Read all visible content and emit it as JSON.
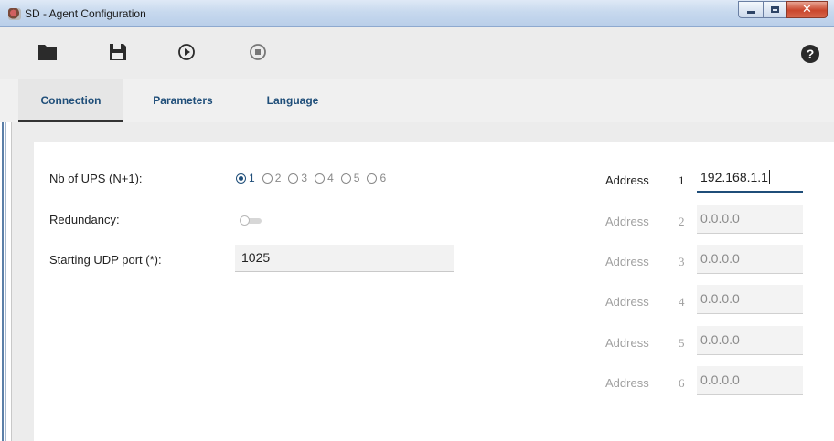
{
  "window": {
    "title": "SD - Agent Configuration"
  },
  "toolbar": {
    "icons": [
      "folder-icon",
      "save-icon",
      "play-icon",
      "stop-icon",
      "help-icon"
    ],
    "help_glyph": "?"
  },
  "tabs": [
    {
      "label": "Connection",
      "active": true
    },
    {
      "label": "Parameters",
      "active": false
    },
    {
      "label": "Language",
      "active": false
    }
  ],
  "connection": {
    "nb_ups_label": "Nb of UPS (N+1):",
    "nb_ups_options": [
      "1",
      "2",
      "3",
      "4",
      "5",
      "6"
    ],
    "nb_ups_selected": "1",
    "redundancy_label": "Redundancy:",
    "redundancy_enabled": false,
    "udp_port_label": "Starting UDP port (*):",
    "udp_port_value": "1025",
    "addresses": [
      {
        "label": "Address",
        "num": "1",
        "value": "192.168.1.1",
        "active": true
      },
      {
        "label": "Address",
        "num": "2",
        "value": "0.0.0.0",
        "active": false
      },
      {
        "label": "Address",
        "num": "3",
        "value": "0.0.0.0",
        "active": false
      },
      {
        "label": "Address",
        "num": "4",
        "value": "0.0.0.0",
        "active": false
      },
      {
        "label": "Address",
        "num": "5",
        "value": "0.0.0.0",
        "active": false
      },
      {
        "label": "Address",
        "num": "6",
        "value": "0.0.0.0",
        "active": false
      }
    ]
  },
  "colors": {
    "accent": "#1f4e79",
    "disabled_text": "#a0a0a0"
  }
}
